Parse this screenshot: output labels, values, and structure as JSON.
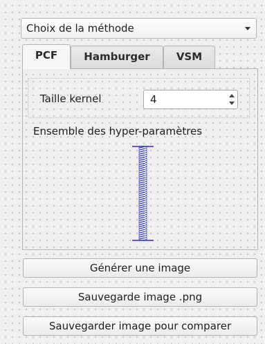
{
  "method_selector": {
    "selected": "Choix de la méthode"
  },
  "tabs": [
    {
      "label": "PCF",
      "active": true
    },
    {
      "label": "Hamburger",
      "active": false
    },
    {
      "label": "VSM",
      "active": false
    }
  ],
  "pcf": {
    "kernel_label": "Taille kernel",
    "kernel_value": "4",
    "hyperparams_label": "Ensemble des hyper-paramètres"
  },
  "buttons": {
    "generate": "Générer une image",
    "save_png": "Sauvegarde image .png",
    "save_compare": "Sauvegarder image pour comparer"
  },
  "icons": {
    "combo_arrow": "chevron-down-icon",
    "spin_up": "triangle-up-icon",
    "spin_down": "triangle-down-icon",
    "slider": "vertical-slider"
  },
  "colors": {
    "slider_accent": "#2a2ad6",
    "window_bg": "#efefef"
  }
}
